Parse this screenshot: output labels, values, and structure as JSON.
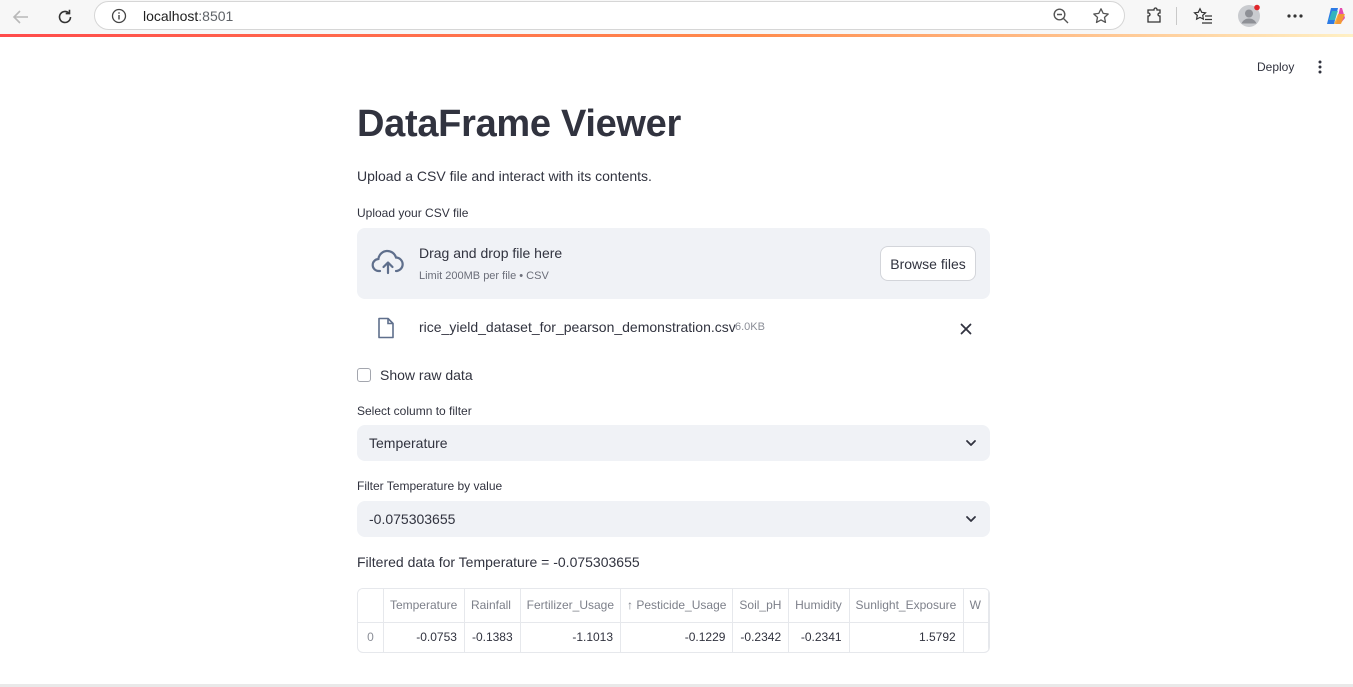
{
  "browser": {
    "url_host": "localhost",
    "url_port": ":8501"
  },
  "header": {
    "deploy_label": "Deploy"
  },
  "page": {
    "title": "DataFrame Viewer",
    "subtitle": "Upload a CSV file and interact with its contents."
  },
  "uploader": {
    "label": "Upload your CSV file",
    "drop_text": "Drag and drop file here",
    "limit_text": "Limit 200MB per file • CSV",
    "browse_label": "Browse files",
    "file_name": "rice_yield_dataset_for_pearson_demonstration.csv",
    "file_size": "6.0KB"
  },
  "show_raw": {
    "label": "Show raw data",
    "checked": false
  },
  "column_select": {
    "label": "Select column to filter",
    "value": "Temperature"
  },
  "value_select": {
    "label": "Filter Temperature by value",
    "value": "-0.075303655"
  },
  "filtered_caption": "Filtered data for Temperature = -0.075303655",
  "table": {
    "columns": [
      "",
      "Temperature",
      "Rainfall",
      "Fertilizer_Usage",
      "↑ Pesticide_Usage",
      "Soil_pH",
      "Humidity",
      "Sunlight_Exposure",
      "W"
    ],
    "rows": [
      [
        "0",
        "-0.0753",
        "-0.1383",
        "-1.1013",
        "-0.1229",
        "-0.2342",
        "-0.2341",
        "1.5792",
        ""
      ]
    ]
  },
  "colors": {
    "accent": "#ff4b4b",
    "input_bg": "#f0f2f6",
    "text": "#31333f"
  }
}
